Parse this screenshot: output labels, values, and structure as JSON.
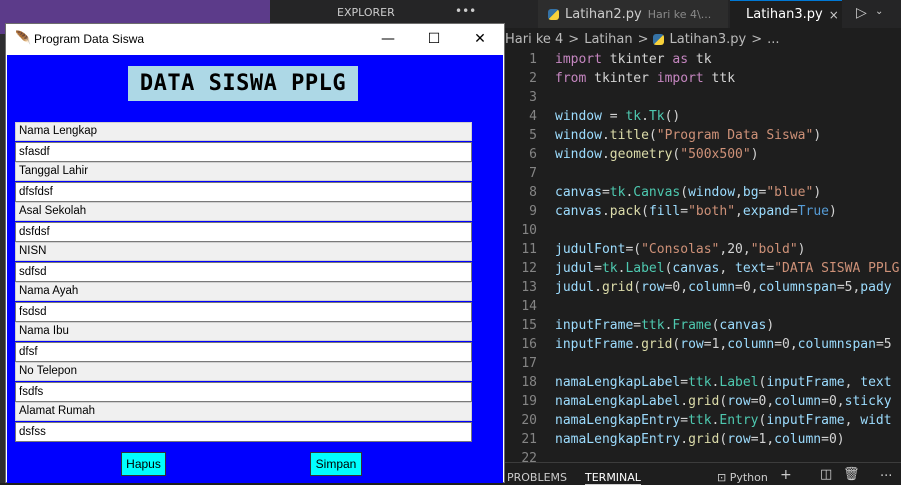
{
  "vscode": {
    "explorer_label": "EXPLORER",
    "explorer_more": "•••",
    "tab1": {
      "name": "Latihan2.py",
      "hint": "Hari ke 4\\..."
    },
    "tab2": {
      "name": "Latihan3.py",
      "close": "×"
    },
    "breadcrumb": {
      "part1": "Hari ke 4",
      "sep": ">",
      "part2": "Latihan",
      "part3": "Latihan3.py",
      "part4": "..."
    },
    "code_lines": [
      {
        "n": "1"
      },
      {
        "n": "2"
      },
      {
        "n": "3"
      },
      {
        "n": "4"
      },
      {
        "n": "5"
      },
      {
        "n": "6"
      },
      {
        "n": "7"
      },
      {
        "n": "8"
      },
      {
        "n": "9"
      },
      {
        "n": "10"
      },
      {
        "n": "11"
      },
      {
        "n": "12"
      },
      {
        "n": "13"
      },
      {
        "n": "14"
      },
      {
        "n": "15"
      },
      {
        "n": "16"
      },
      {
        "n": "17"
      },
      {
        "n": "18"
      },
      {
        "n": "19"
      },
      {
        "n": "20"
      },
      {
        "n": "21"
      },
      {
        "n": "22"
      }
    ],
    "code_text": {
      "l1": [
        "import",
        " tkinter ",
        "as",
        " tk"
      ],
      "l2": [
        "from",
        " tkinter ",
        "import",
        " ttk"
      ],
      "l4": [
        "window",
        " = ",
        "tk",
        ".",
        "Tk",
        "()"
      ],
      "l5": [
        "window",
        ".",
        "title",
        "(",
        "\"Program Data Siswa\"",
        ")"
      ],
      "l6": [
        "window",
        ".",
        "geometry",
        "(",
        "\"500x500\"",
        ")"
      ],
      "l8": [
        "canvas",
        "=",
        "tk",
        ".",
        "Canvas",
        "(",
        "window",
        ",",
        "bg",
        "=",
        "\"blue\"",
        ")"
      ],
      "l9": [
        "canvas",
        ".",
        "pack",
        "(",
        "fill",
        "=",
        "\"both\"",
        ",",
        "expand",
        "=",
        "True",
        ")"
      ],
      "l11": [
        "judulFont",
        "=(",
        "\"Consolas\"",
        ",",
        "20",
        ",",
        "\"bold\"",
        ")"
      ],
      "l12": [
        "judul",
        "=",
        "tk",
        ".",
        "Label",
        "(",
        "canvas",
        ", ",
        "text",
        "=",
        "\"DATA SISWA PPLG"
      ],
      "l13": [
        "judul",
        ".",
        "grid",
        "(",
        "row",
        "=",
        "0",
        ",",
        "column",
        "=",
        "0",
        ",",
        "columnspan",
        "=",
        "5",
        ",",
        "pady"
      ],
      "l15": [
        "inputFrame",
        "=",
        "ttk",
        ".",
        "Frame",
        "(",
        "canvas",
        ")"
      ],
      "l16": [
        "inputFrame",
        ".",
        "grid",
        "(",
        "row",
        "=",
        "1",
        ",",
        "column",
        "=",
        "0",
        ",",
        "columnspan",
        "=",
        "5"
      ],
      "l18": [
        "namaLengkapLabel",
        "=",
        "ttk",
        ".",
        "Label",
        "(",
        "inputFrame",
        ", ",
        "text"
      ],
      "l19": [
        "namaLengkapLabel",
        ".",
        "grid",
        "(",
        "row",
        "=",
        "0",
        ",",
        "column",
        "=",
        "0",
        ",",
        "sticky"
      ],
      "l20": [
        "namaLengkapEntry",
        "=",
        "ttk",
        ".",
        "Entry",
        "(",
        "inputFrame",
        ", ",
        "widt"
      ],
      "l21": [
        "namaLengkapEntry",
        ".",
        "grid",
        "(",
        "row",
        "=",
        "1",
        ",",
        "column",
        "=",
        "0",
        ")"
      ]
    },
    "panel": {
      "problems": "PROBLEMS",
      "terminal": "TERMINAL",
      "python": "Python",
      "more": "..."
    }
  },
  "tk": {
    "window_title": "Program Data Siswa",
    "heading": "DATA SISWA PPLG",
    "fields": [
      {
        "label": "Nama Lengkap",
        "value": "sfasdf"
      },
      {
        "label": "Tanggal Lahir",
        "value": "dfsfdsf"
      },
      {
        "label": "Asal Sekolah",
        "value": "dsfdsf"
      },
      {
        "label": "NISN",
        "value": "sdfsd"
      },
      {
        "label": "Nama Ayah",
        "value": "fsdsd"
      },
      {
        "label": "Nama Ibu",
        "value": "dfsf"
      },
      {
        "label": "No Telepon",
        "value": "fsdfs"
      },
      {
        "label": "Alamat Rumah",
        "value": "dsfss"
      }
    ],
    "hapus_label": "Hapus",
    "simpan_label": "Simpan",
    "canvas_color": "#0000ff",
    "heading_bg": "#add8e6",
    "button_bg": "#00ffff"
  }
}
